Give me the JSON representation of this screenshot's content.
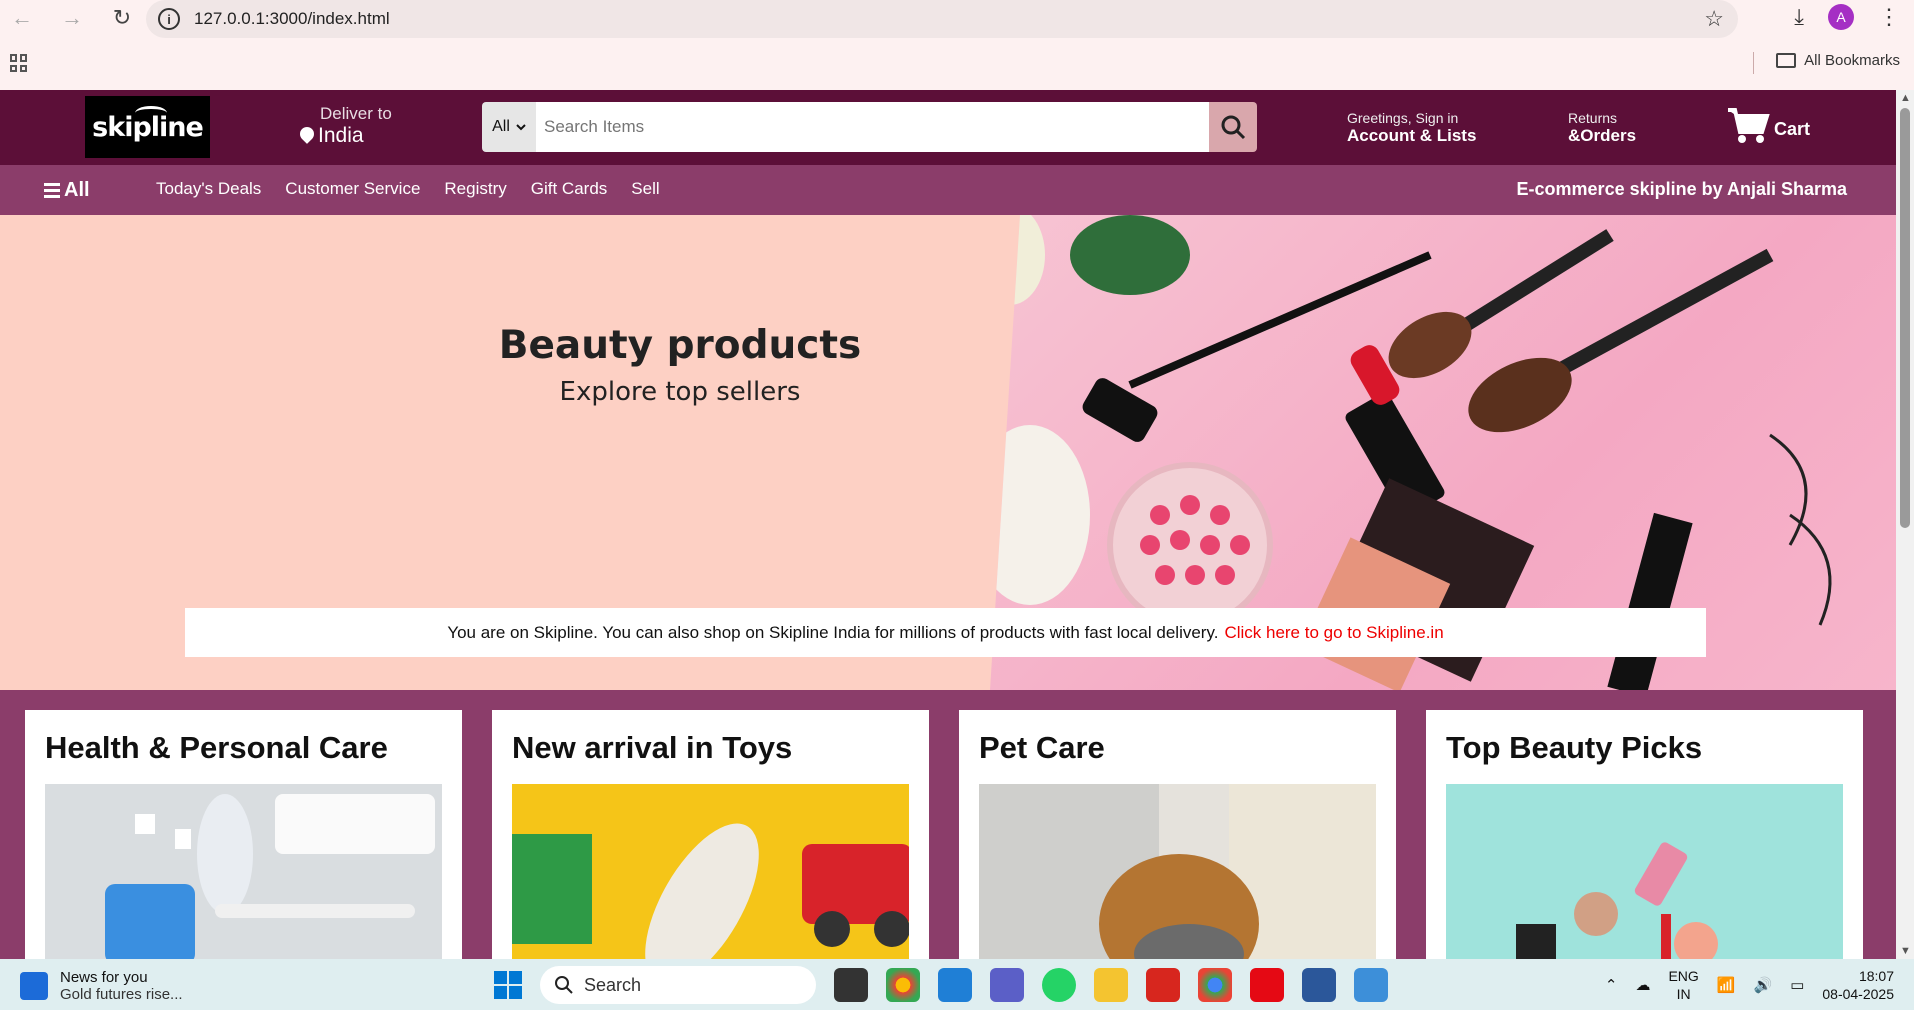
{
  "browser": {
    "url": "127.0.0.1:3000/index.html",
    "bookmarks_label": "All Bookmarks",
    "profile_initial": "A"
  },
  "header": {
    "logo_text": "skipline",
    "deliver_line1": "Deliver to",
    "deliver_line2": "India",
    "search_category": "All",
    "search_placeholder": "Search Items",
    "account_line1": "Greetings, Sign in",
    "account_line2": "Account & Lists",
    "returns_line1": "Returns",
    "returns_line2": "&Orders",
    "cart_label": "Cart"
  },
  "subnav": {
    "all_label": "All",
    "items": [
      "Today's Deals",
      "Customer Service",
      "Registry",
      "Gift Cards",
      "Sell"
    ],
    "brand_text": "E-commerce skipline by Anjali Sharma"
  },
  "hero": {
    "title": "Beauty products",
    "subtitle": "Explore top sellers",
    "notice_text": "You are on Skipline. You can also shop on Skipline India for millions of products with fast local delivery.",
    "notice_link": "Click here to go to Skipline.in"
  },
  "cards": [
    {
      "title": "Health & Personal Care",
      "color": "#d9dde0"
    },
    {
      "title": "New arrival in Toys",
      "color": "#f5c518"
    },
    {
      "title": "Pet Care",
      "color": "#e5e2dc"
    },
    {
      "title": "Top Beauty Picks",
      "color": "#9fe3dc"
    }
  ],
  "taskbar": {
    "news_title": "News for you",
    "news_sub": "Gold futures rise...",
    "search_label": "Search",
    "lang_line1": "ENG",
    "lang_line2": "IN",
    "time": "18:07",
    "date": "08-04-2025"
  },
  "colors": {
    "topbar": "#5c0f38",
    "subbar": "#8b3d6a",
    "hero_bg": "#fdd0c4",
    "link": "#ee0000"
  }
}
